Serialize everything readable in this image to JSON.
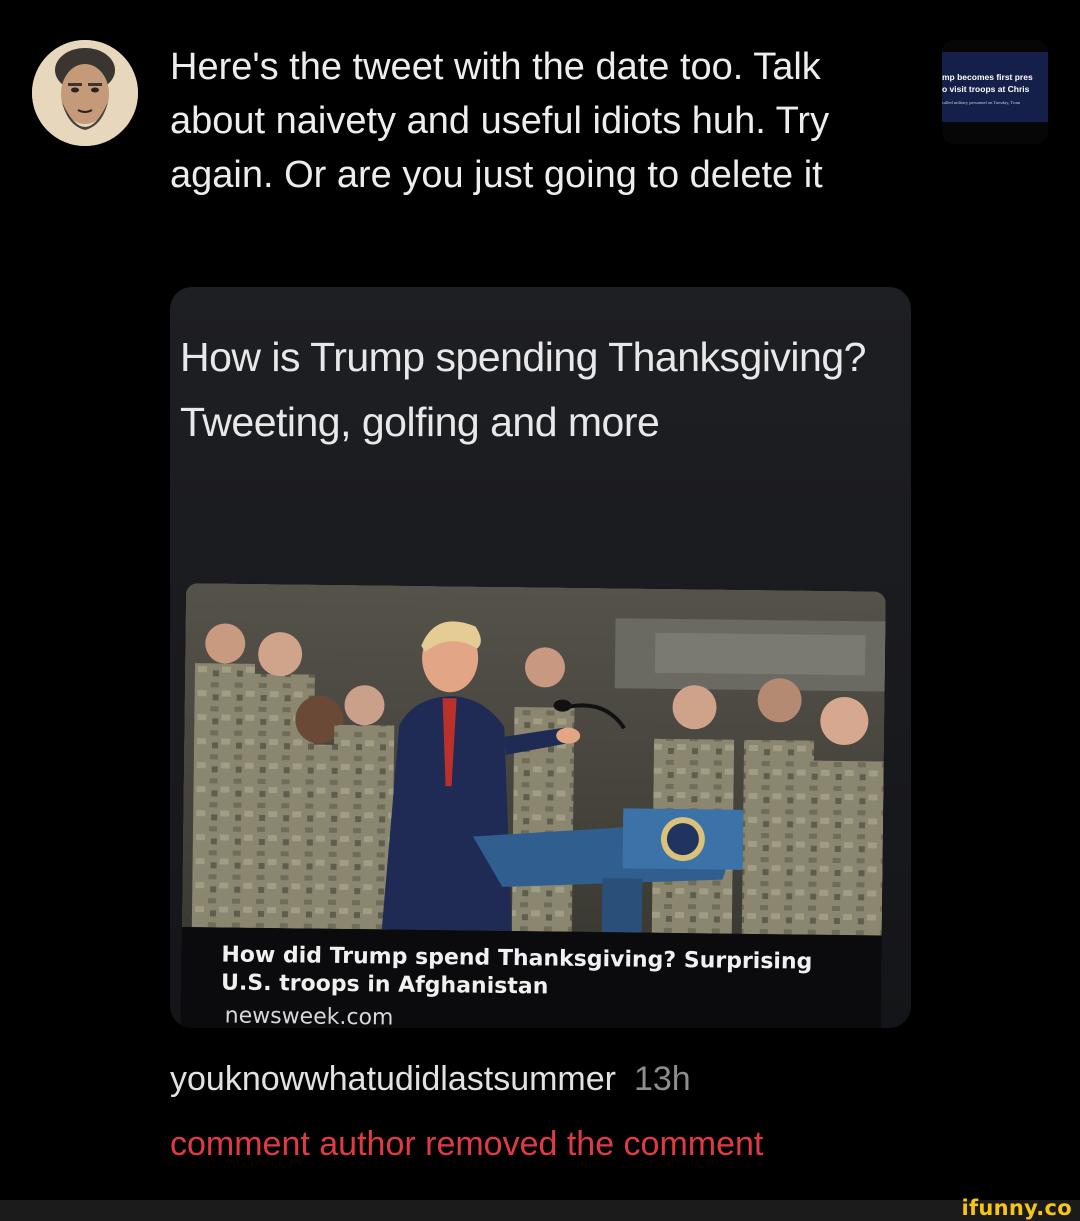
{
  "comment": {
    "text": "Here's the tweet with the date too. Talk about naivety and useful idiots huh. Try again. Or are you just going to delete it",
    "username": "youknowwhatudidlastsummer",
    "timestamp": "13h",
    "removed_notice": "comment author removed the comment"
  },
  "thumbnail": {
    "line1": "mp becomes first pres",
    "line2": "o visit troops at Chris",
    "line3": "called military personnel on Tuesday, Trum"
  },
  "attachment": {
    "headline": "How is Trump spending Thanksgiving? Tweeting, golfing and more",
    "card_title": "How did Trump spend Thanksgiving? Surprising U.S. troops in Afghanistan",
    "card_source": "newsweek.com"
  },
  "watermark": "ifunny.co",
  "colors": {
    "background": "#000000",
    "text": "#ededed",
    "timestamp": "#8d8d8d",
    "removed": "#e03b45",
    "watermark": "#f5c518"
  }
}
